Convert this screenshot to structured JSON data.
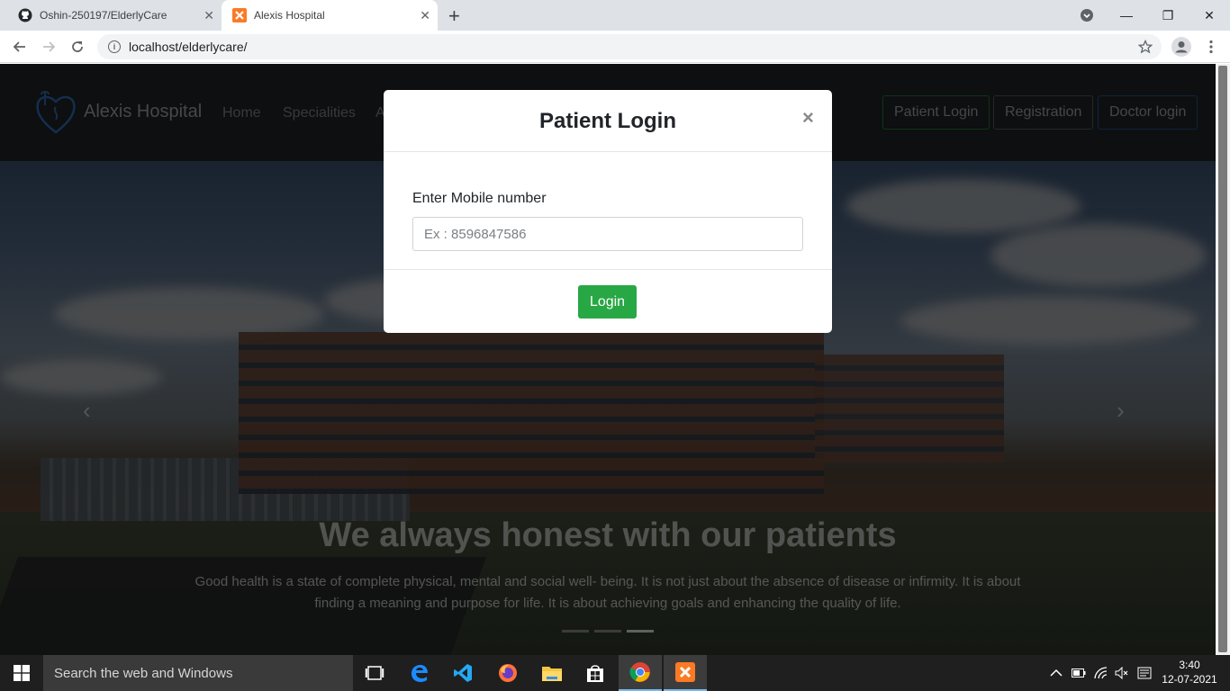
{
  "browser": {
    "tabs": [
      {
        "title": "Oshin-250197/ElderlyCare",
        "close": "✕"
      },
      {
        "title": "Alexis Hospital",
        "close": "✕"
      }
    ],
    "new_tab": "+",
    "url": "localhost/elderlycare/",
    "window_controls": {
      "minimize": "—",
      "maximize": "❐",
      "close": "✕"
    }
  },
  "site": {
    "brand": "Alexis Hospital",
    "nav": [
      "Home",
      "Specialities",
      "A"
    ],
    "buttons": {
      "patient_login": "Patient Login",
      "registration": "Registration",
      "doctor_login": "Doctor login"
    },
    "colors": {
      "patient_login_border": "#28a745",
      "doctor_login_border": "#3b7dd8",
      "registration_border": "#6c757d"
    }
  },
  "hero": {
    "title": "We always honest with our patients",
    "text": "Good health is a state of complete physical, mental and social well- being. It is not just about the absence of disease or infirmity. It is about finding a meaning and purpose for life. It is about achieving goals and enhancing the quality of life.",
    "prev": "‹",
    "next": "›",
    "slide_count": 3,
    "active_slide": 3
  },
  "modal": {
    "title": "Patient Login",
    "close": "×",
    "label": "Enter Mobile number",
    "placeholder": "Ex : 8596847586",
    "value": "",
    "submit": "Login",
    "submit_color": "#28a745"
  },
  "taskbar": {
    "search_placeholder": "Search the web and Windows",
    "apps": [
      "task-view-icon",
      "edge-icon",
      "vscode-icon",
      "firefox-icon",
      "file-explorer-icon",
      "store-icon",
      "chrome-icon",
      "xampp-icon"
    ],
    "time": "3:40",
    "date": "12-07-2021"
  }
}
